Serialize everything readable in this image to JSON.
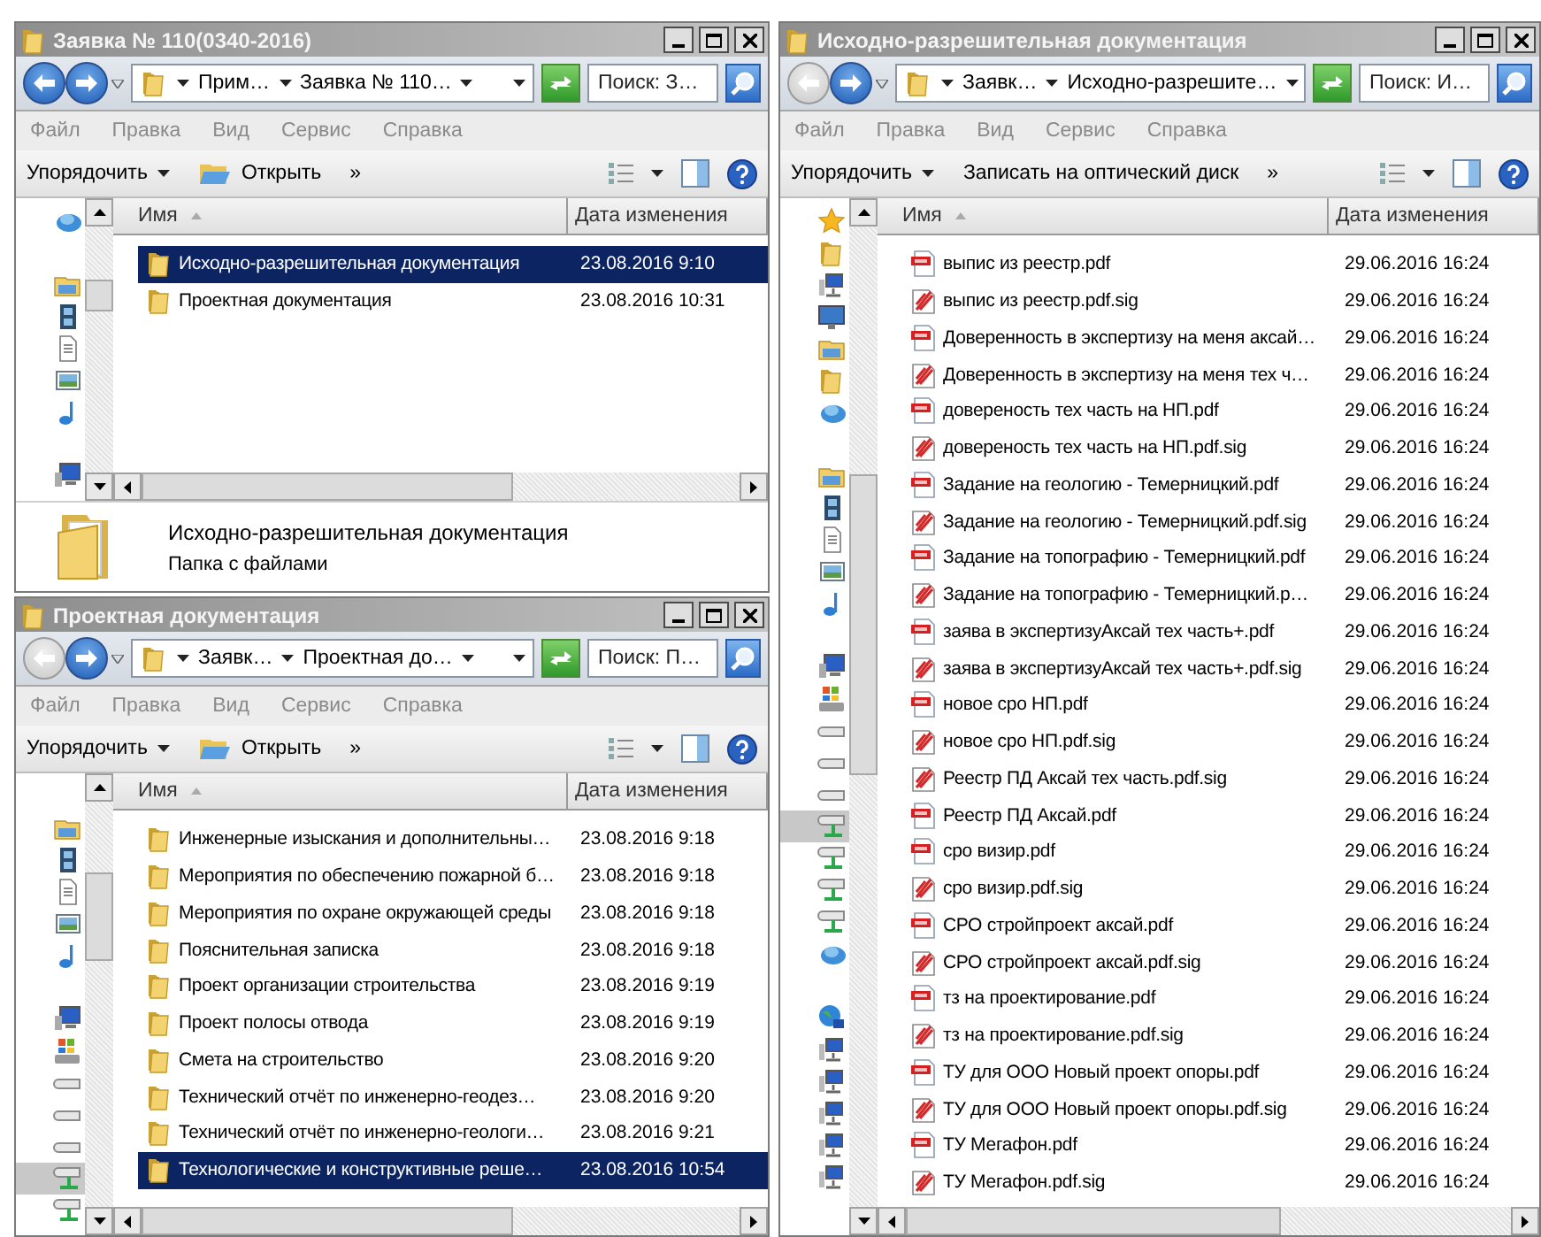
{
  "windows": [
    {
      "title": "Заявка № 110(0340-2016)",
      "back_disabled": false,
      "breadcrumbs": [
        "Прим…",
        "Заявка № 110…"
      ],
      "search": {
        "placeholder": "Поиск: З…"
      },
      "menu": [
        "Файл",
        "Правка",
        "Вид",
        "Сервис",
        "Справка"
      ],
      "toolbar": [
        {
          "label": "Упорядочить",
          "kind": "dropdown"
        },
        {
          "label": "Открыть",
          "kind": "open"
        },
        {
          "label": "»",
          "kind": "overflow"
        }
      ],
      "columns": [
        {
          "label": "Имя",
          "sorted": true
        },
        {
          "label": "Дата изменения",
          "sorted": false
        }
      ],
      "nav_items": [
        {
          "kind": "cloud",
          "selected": false
        },
        {
          "kind": "library",
          "selected": false,
          "separated": true
        },
        {
          "kind": "film",
          "selected": false
        },
        {
          "kind": "document",
          "selected": false
        },
        {
          "kind": "picture",
          "selected": false
        },
        {
          "kind": "music",
          "selected": false
        },
        {
          "kind": "computer",
          "selected": false,
          "separated": true
        }
      ],
      "rows": [
        {
          "kind": "folder",
          "name": "Исходно-разрешительная документация",
          "date": "23.08.2016 9:10",
          "selected": true
        },
        {
          "kind": "folder",
          "name": "Проектная документация",
          "date": "23.08.2016 10:31",
          "selected": false
        }
      ],
      "details": {
        "name": "Исходно-разрешительная документация",
        "type": "Папка с файлами"
      }
    },
    {
      "title": "Проектная документация",
      "back_disabled": true,
      "breadcrumbs": [
        "Заявк…",
        "Проектная до…"
      ],
      "search": {
        "placeholder": "Поиск: П…"
      },
      "menu": [
        "Файл",
        "Правка",
        "Вид",
        "Сервис",
        "Справка"
      ],
      "toolbar": [
        {
          "label": "Упорядочить",
          "kind": "dropdown"
        },
        {
          "label": "Открыть",
          "kind": "open"
        },
        {
          "label": "»",
          "kind": "overflow"
        }
      ],
      "columns": [
        {
          "label": "Имя",
          "sorted": true
        },
        {
          "label": "Дата изменения",
          "sorted": false
        }
      ],
      "nav_items": [
        {
          "kind": "library",
          "selected": false,
          "separated": true
        },
        {
          "kind": "film",
          "selected": false
        },
        {
          "kind": "document",
          "selected": false
        },
        {
          "kind": "picture",
          "selected": false
        },
        {
          "kind": "music",
          "selected": false
        },
        {
          "kind": "computer",
          "selected": false,
          "separated": true
        },
        {
          "kind": "windows-drive",
          "selected": false
        },
        {
          "kind": "drive",
          "selected": false
        },
        {
          "kind": "drive",
          "selected": false
        },
        {
          "kind": "drive",
          "selected": false
        },
        {
          "kind": "network-drive",
          "selected": true
        },
        {
          "kind": "network-drive",
          "selected": false
        }
      ],
      "rows": [
        {
          "kind": "folder",
          "name": "Инженерные изыскания и дополнительны…",
          "date": "23.08.2016 9:18",
          "selected": false
        },
        {
          "kind": "folder",
          "name": "Мероприятия по обеспечению пожарной б…",
          "date": "23.08.2016 9:18",
          "selected": false
        },
        {
          "kind": "folder",
          "name": "Мероприятия по охране окружающей среды",
          "date": "23.08.2016 9:18",
          "selected": false
        },
        {
          "kind": "folder",
          "name": "Пояснительная записка",
          "date": "23.08.2016 9:18",
          "selected": false
        },
        {
          "kind": "folder",
          "name": "Проект организации строительства",
          "date": "23.08.2016 9:19",
          "selected": false
        },
        {
          "kind": "folder",
          "name": "Проект полосы отвода",
          "date": "23.08.2016 9:19",
          "selected": false
        },
        {
          "kind": "folder",
          "name": "Смета на строительство",
          "date": "23.08.2016 9:20",
          "selected": false
        },
        {
          "kind": "folder",
          "name": "Технический отчёт по инженерно-геодез…",
          "date": "23.08.2016 9:20",
          "selected": false
        },
        {
          "kind": "folder",
          "name": "Технический отчёт по инженерно-геологи…",
          "date": "23.08.2016 9:21",
          "selected": false
        },
        {
          "kind": "folder",
          "name": "Технологические и конструктивные реше…",
          "date": "23.08.2016 10:54",
          "selected": true
        }
      ]
    },
    {
      "title": "Исходно-разрешительная документация",
      "back_disabled": true,
      "breadcrumbs": [
        "Заявк…",
        "Исходно-разрешите…"
      ],
      "search": {
        "placeholder": "Поиск: И…"
      },
      "menu": [
        "Файл",
        "Правка",
        "Вид",
        "Сервис",
        "Справка"
      ],
      "toolbar": [
        {
          "label": "Упорядочить",
          "kind": "dropdown"
        },
        {
          "label": "Записать на оптический диск",
          "kind": "plain"
        },
        {
          "label": "»",
          "kind": "overflow"
        }
      ],
      "columns": [
        {
          "label": "Имя",
          "sorted": true
        },
        {
          "label": "Дата изменения",
          "sorted": false
        }
      ],
      "nav_items": [
        {
          "kind": "star",
          "selected": false
        },
        {
          "kind": "folder",
          "selected": false
        },
        {
          "kind": "network-computer",
          "selected": false
        },
        {
          "kind": "desktop",
          "selected": false
        },
        {
          "kind": "library",
          "selected": false
        },
        {
          "kind": "folder",
          "selected": false
        },
        {
          "kind": "cloud",
          "selected": false
        },
        {
          "kind": "library",
          "selected": false,
          "separated": true
        },
        {
          "kind": "film",
          "selected": false
        },
        {
          "kind": "document",
          "selected": false
        },
        {
          "kind": "picture",
          "selected": false
        },
        {
          "kind": "music",
          "selected": false
        },
        {
          "kind": "computer",
          "selected": false,
          "separated": true
        },
        {
          "kind": "windows-drive",
          "selected": false
        },
        {
          "kind": "drive",
          "selected": false
        },
        {
          "kind": "drive",
          "selected": false
        },
        {
          "kind": "drive",
          "selected": false
        },
        {
          "kind": "network-drive",
          "selected": true
        },
        {
          "kind": "network-drive",
          "selected": false
        },
        {
          "kind": "network-drive",
          "selected": false
        },
        {
          "kind": "network-drive",
          "selected": false
        },
        {
          "kind": "cloud",
          "selected": false
        },
        {
          "kind": "globe",
          "selected": false,
          "separated": true
        },
        {
          "kind": "network-computer",
          "selected": false
        },
        {
          "kind": "network-computer",
          "selected": false
        },
        {
          "kind": "network-computer",
          "selected": false
        },
        {
          "kind": "network-computer",
          "selected": false
        },
        {
          "kind": "network-computer",
          "selected": false
        }
      ],
      "rows": [
        {
          "kind": "pdf",
          "name": "выпис из реестр.pdf",
          "date": "29.06.2016 16:24",
          "selected": false
        },
        {
          "kind": "sig",
          "name": "выпис из реестр.pdf.sig",
          "date": "29.06.2016 16:24",
          "selected": false
        },
        {
          "kind": "pdf",
          "name": "Доверенность в экспертизу на меня аксай…",
          "date": "29.06.2016 16:24",
          "selected": false
        },
        {
          "kind": "sig",
          "name": "Доверенность в экспертизу на меня тех ч…",
          "date": "29.06.2016 16:24",
          "selected": false
        },
        {
          "kind": "pdf",
          "name": "довереность тех часть на НП.pdf",
          "date": "29.06.2016 16:24",
          "selected": false
        },
        {
          "kind": "sig",
          "name": "довереность тех часть на НП.pdf.sig",
          "date": "29.06.2016 16:24",
          "selected": false
        },
        {
          "kind": "pdf",
          "name": "Задание на геологию - Темерницкий.pdf",
          "date": "29.06.2016 16:24",
          "selected": false
        },
        {
          "kind": "sig",
          "name": "Задание на геологию - Темерницкий.pdf.sig",
          "date": "29.06.2016 16:24",
          "selected": false
        },
        {
          "kind": "pdf",
          "name": "Задание на топографию - Темерницкий.pdf",
          "date": "29.06.2016 16:24",
          "selected": false
        },
        {
          "kind": "sig",
          "name": "Задание на топографию - Темерницкий.p…",
          "date": "29.06.2016 16:24",
          "selected": false
        },
        {
          "kind": "pdf",
          "name": "заява в экспертизуАксай тех часть+.pdf",
          "date": "29.06.2016 16:24",
          "selected": false
        },
        {
          "kind": "sig",
          "name": "заява в экспертизуАксай тех часть+.pdf.sig",
          "date": "29.06.2016 16:24",
          "selected": false
        },
        {
          "kind": "pdf",
          "name": "новое сро НП.pdf",
          "date": "29.06.2016 16:24",
          "selected": false
        },
        {
          "kind": "sig",
          "name": "новое сро НП.pdf.sig",
          "date": "29.06.2016 16:24",
          "selected": false
        },
        {
          "kind": "sig",
          "name": "Реестр ПД Аксай тех часть.pdf.sig",
          "date": "29.06.2016 16:24",
          "selected": false
        },
        {
          "kind": "pdf",
          "name": "Реестр ПД Аксай.pdf",
          "date": "29.06.2016 16:24",
          "selected": false
        },
        {
          "kind": "pdf",
          "name": "сро визир.pdf",
          "date": "29.06.2016 16:24",
          "selected": false
        },
        {
          "kind": "sig",
          "name": "сро визир.pdf.sig",
          "date": "29.06.2016 16:24",
          "selected": false
        },
        {
          "kind": "pdf",
          "name": "СРО стройпроект аксай.pdf",
          "date": "29.06.2016 16:24",
          "selected": false
        },
        {
          "kind": "sig",
          "name": "СРО стройпроект аксай.pdf.sig",
          "date": "29.06.2016 16:24",
          "selected": false
        },
        {
          "kind": "pdf",
          "name": "тз на проектирование.pdf",
          "date": "29.06.2016 16:24",
          "selected": false
        },
        {
          "kind": "sig",
          "name": "тз на проектирование.pdf.sig",
          "date": "29.06.2016 16:24",
          "selected": false
        },
        {
          "kind": "pdf",
          "name": "ТУ для ООО Новый проект опоры.pdf",
          "date": "29.06.2016 16:24",
          "selected": false
        },
        {
          "kind": "sig",
          "name": "ТУ для ООО Новый проект опоры.pdf.sig",
          "date": "29.06.2016 16:24",
          "selected": false
        },
        {
          "kind": "pdf",
          "name": "ТУ Мегафон.pdf",
          "date": "29.06.2016 16:24",
          "selected": false
        },
        {
          "kind": "sig",
          "name": "ТУ Мегафон.pdf.sig",
          "date": "29.06.2016 16:24",
          "selected": false
        }
      ]
    }
  ]
}
